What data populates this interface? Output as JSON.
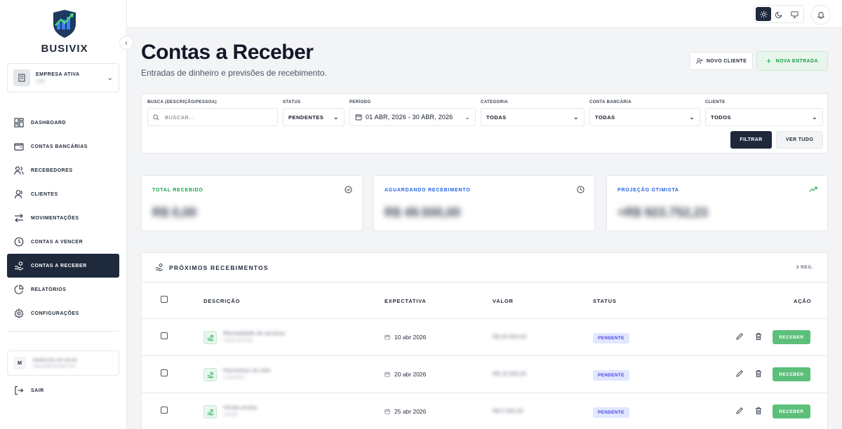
{
  "brand": {
    "name": "BUSIVIX"
  },
  "company": {
    "label": "EMPRESA ATIVA",
    "name": "UMI"
  },
  "nav": [
    {
      "id": "dashboard",
      "label": "DASHBOARD",
      "icon": "grid-icon"
    },
    {
      "id": "bank-accounts",
      "label": "CONTAS BANCÁRIAS",
      "icon": "wallet-icon"
    },
    {
      "id": "receivers",
      "label": "RECEBEDORES",
      "icon": "users-icon"
    },
    {
      "id": "clients",
      "label": "CLIENTES",
      "icon": "user-icon"
    },
    {
      "id": "movements",
      "label": "MOVIMENTAÇÕES",
      "icon": "arrows-icon"
    },
    {
      "id": "payables",
      "label": "CONTAS A VENCER",
      "icon": "clock-icon"
    },
    {
      "id": "receivables",
      "label": "CONTAS A RECEBER",
      "icon": "hand-coin-icon",
      "active": true
    },
    {
      "id": "reports",
      "label": "RELATÓRIOS",
      "icon": "pie-chart-icon"
    },
    {
      "id": "settings",
      "label": "CONFIGURAÇÕES",
      "icon": "gear-icon"
    }
  ],
  "user": {
    "initial": "M",
    "name": "MARCOS DA SILVA",
    "email": "marcos@exemplo.com"
  },
  "logout_label": "SAIR",
  "header": {
    "title": "Contas a Receber",
    "subtitle": "Entradas de dinheiro e previsões de recebimento.",
    "new_client_label": "NOVO CLIENTE",
    "new_entry_label": "NOVA ENTRADA"
  },
  "filters": {
    "search": {
      "label": "BUSCA (DESCRIÇÃO/PESSOA)",
      "placeholder": "BUSCAR..."
    },
    "status": {
      "label": "STATUS",
      "value": "PENDENTES"
    },
    "period": {
      "label": "PERÍODO",
      "value": "01 ABR, 2026 - 30 ABR, 2026"
    },
    "category": {
      "label": "CATEGORIA",
      "value": "TODAS"
    },
    "bank_account": {
      "label": "CONTA BANCÁRIA",
      "value": "TODAS"
    },
    "client": {
      "label": "CLIENTE",
      "value": "TODOS"
    },
    "filter_button": "FILTRAR",
    "see_all_button": "VER TUDO"
  },
  "stats": [
    {
      "label": "TOTAL RECEBIDO",
      "value": "R$ 0,00",
      "color": "#16a34a",
      "icon": "check-circle-icon"
    },
    {
      "label": "AGUARDANDO RECEBIMENTO",
      "value": "R$ 49.500,00",
      "color": "#2563eb",
      "icon": "clock-icon"
    },
    {
      "label": "PROJEÇÃO OTIMISTA",
      "value": "+R$ 923.752,23",
      "color": "#2563eb",
      "icon": "trending-up-icon"
    }
  ],
  "table": {
    "title": "PRÓXIMOS RECEBIMENTOS",
    "count": "3 REG.",
    "columns": {
      "description": "DESCRIÇÃO",
      "expectation": "EXPECTATIVA",
      "value": "VALOR",
      "status": "STATUS",
      "action": "AÇÃO"
    },
    "rows": [
      {
        "description": "Mensalidade de serviços",
        "sub": "Cliente principal",
        "date": "10 abr 2026",
        "value": "R$ 20.000,00",
        "status": "PENDENTE",
        "action": "RECEBER"
      },
      {
        "description": "Honorários do mês",
        "sub": "Consultoria",
        "date": "20 abr 2026",
        "value": "R$ 24.500,00",
        "status": "PENDENTE",
        "action": "RECEBER"
      },
      {
        "description": "Venda avulsa",
        "sub": "Produto",
        "date": "25 abr 2026",
        "value": "R$ 5.000,00",
        "status": "PENDENTE",
        "action": "RECEBER"
      }
    ]
  },
  "colors": {
    "primary_dark": "#1e293b",
    "accent_green": "#16a34a",
    "accent_blue": "#2563eb"
  }
}
